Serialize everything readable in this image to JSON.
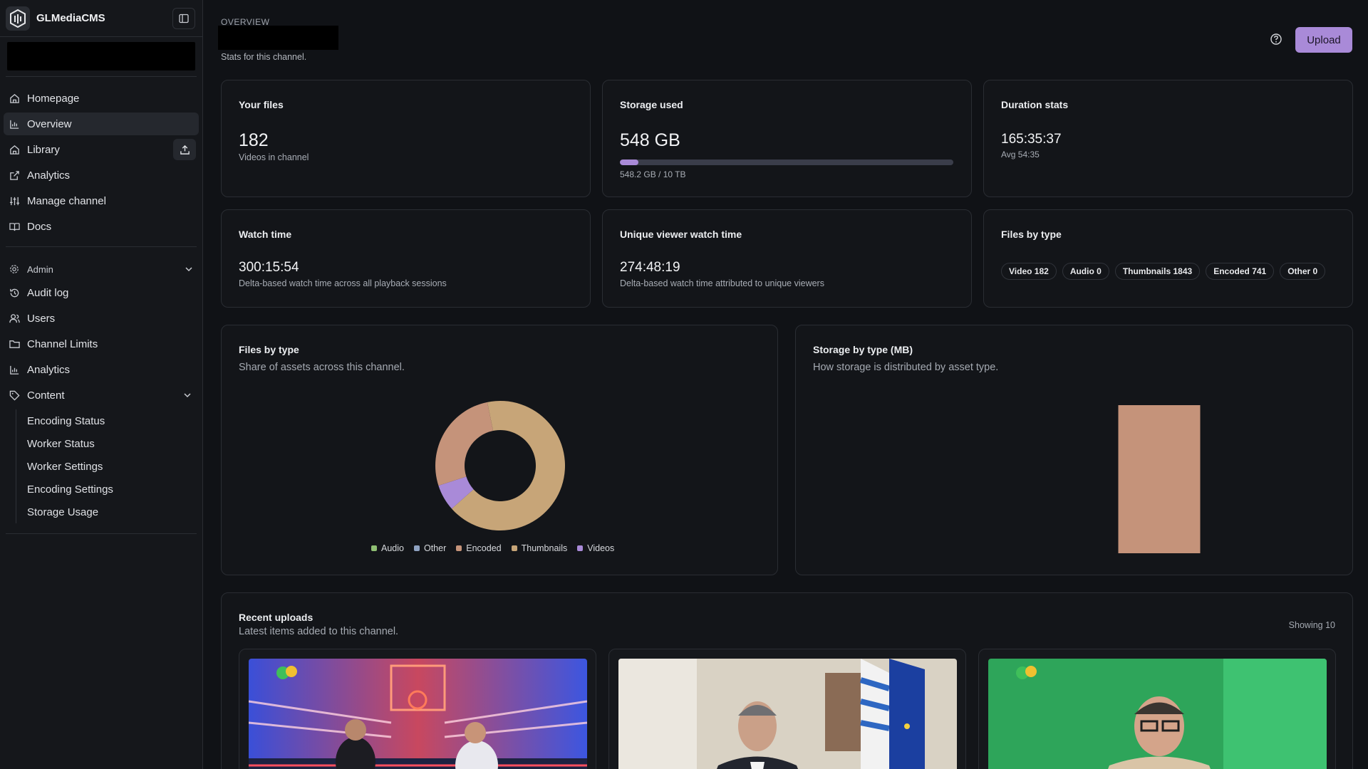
{
  "app": {
    "name": "GLMediaCMS"
  },
  "sidebar": {
    "nav": [
      {
        "label": "Homepage",
        "icon": "home-icon"
      },
      {
        "label": "Overview",
        "icon": "bar-chart-icon",
        "active": true
      },
      {
        "label": "Library",
        "icon": "home-icon"
      },
      {
        "label": "Analytics",
        "icon": "external-link-icon"
      },
      {
        "label": "Manage channel",
        "icon": "sliders-icon"
      },
      {
        "label": "Docs",
        "icon": "book-icon"
      }
    ],
    "admin": {
      "label": "Admin",
      "items": [
        {
          "label": "Audit log",
          "icon": "history-icon"
        },
        {
          "label": "Users",
          "icon": "users-icon"
        },
        {
          "label": "Channel Limits",
          "icon": "folder-icon"
        },
        {
          "label": "Analytics",
          "icon": "bar-chart-icon"
        }
      ],
      "content": {
        "label": "Content",
        "items": [
          "Encoding Status",
          "Worker Status",
          "Worker Settings",
          "Encoding Settings",
          "Storage Usage"
        ]
      }
    }
  },
  "header": {
    "section_label": "OVERVIEW",
    "subtitle": "Stats for this channel.",
    "upload_label": "Upload"
  },
  "stats": {
    "files": {
      "title": "Your files",
      "value": "182",
      "caption": "Videos in channel"
    },
    "storage": {
      "title": "Storage used",
      "value": "548 GB",
      "caption": "548.2 GB / 10 TB",
      "fraction": 0.0548
    },
    "duration": {
      "title": "Duration stats",
      "value": "165:35:37",
      "caption": "Avg 54:35"
    },
    "watch": {
      "title": "Watch time",
      "value": "300:15:54",
      "caption": "Delta-based watch time across all playback sessions"
    },
    "unique": {
      "title": "Unique viewer watch time",
      "value": "274:48:19",
      "caption": "Delta-based watch time attributed to unique viewers"
    },
    "types": {
      "title": "Files by type",
      "chips": [
        "Video 182",
        "Audio 0",
        "Thumbnails 1843",
        "Encoded 741",
        "Other 0"
      ]
    }
  },
  "files_chart": {
    "title": "Files by type",
    "description": "Share of assets across this channel."
  },
  "storage_chart": {
    "title": "Storage by type (MB)",
    "description": "How storage is distributed by asset type."
  },
  "chart_data": [
    {
      "type": "pie",
      "donut": true,
      "categories": [
        "Audio",
        "Other",
        "Encoded",
        "Thumbnails",
        "Videos"
      ],
      "values": [
        0,
        0,
        741,
        1843,
        182
      ],
      "colors": [
        "#8fbf73",
        "#8fa2c2",
        "#c5937a",
        "#c7a578",
        "#a98ad8"
      ],
      "legend": "bottom"
    },
    {
      "type": "bar",
      "categories": [
        ""
      ],
      "values": [
        548200
      ],
      "colors": [
        "#c5937a"
      ],
      "ylim": [
        0,
        548200
      ]
    }
  ],
  "recent": {
    "title": "Recent uploads",
    "description": "Latest items added to this channel.",
    "showing": "Showing 10"
  }
}
